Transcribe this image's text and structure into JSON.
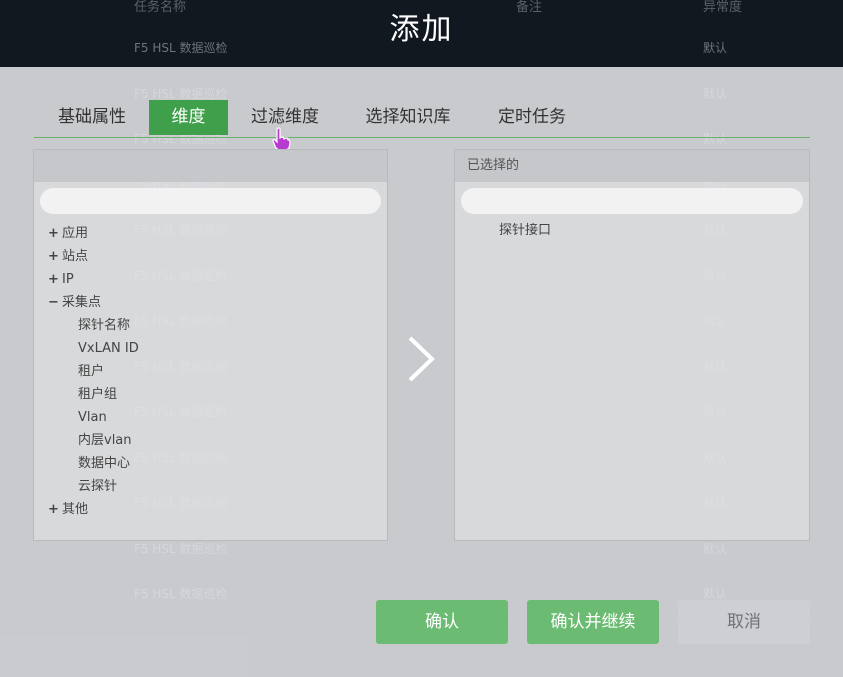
{
  "background": {
    "headers": [
      "任务名称",
      "备注",
      "异常度"
    ],
    "rows": [
      {
        "name": "F5 HSL 数据巡检",
        "level": "默认"
      },
      {
        "name": "F5 HSL 数据巡检",
        "level": "默认"
      },
      {
        "name": "F5 HSL 数据巡检",
        "level": "默认"
      },
      {
        "name": "F5 HSL 数据巡检",
        "level": "默认"
      },
      {
        "name": "F5 HSL 数据巡检",
        "level": "默认"
      },
      {
        "name": "F5 HSL 数据巡检",
        "level": "默认"
      },
      {
        "name": "F5 HSL 数据巡检",
        "level": "默认"
      },
      {
        "name": "F5 HSL 数据巡检",
        "level": "默认"
      },
      {
        "name": "F5 HSL 数据巡检",
        "level": "默认"
      },
      {
        "name": "F5 HSL 数据巡检",
        "level": "默认"
      },
      {
        "name": "F5 HSL 数据巡检",
        "level": "默认"
      },
      {
        "name": "F5 HSL 数据巡检",
        "level": "默认"
      },
      {
        "name": "F5 HSL 数据巡检",
        "level": "默认"
      }
    ]
  },
  "dialog": {
    "title": "添加",
    "tabs": [
      "基础属性",
      "维度",
      "过滤维度",
      "选择知识库",
      "定时任务"
    ],
    "active_tab": "维度",
    "left_panel": {
      "header": "",
      "tree": [
        {
          "sign": "+",
          "label": "应用"
        },
        {
          "sign": "+",
          "label": "站点"
        },
        {
          "sign": "+",
          "label": "IP"
        },
        {
          "sign": "−",
          "label": "采集点"
        },
        {
          "sign": "",
          "label": "探针名称"
        },
        {
          "sign": "",
          "label": "VxLAN ID"
        },
        {
          "sign": "",
          "label": "租户"
        },
        {
          "sign": "",
          "label": "租户组"
        },
        {
          "sign": "",
          "label": "Vlan"
        },
        {
          "sign": "",
          "label": "内层vlan"
        },
        {
          "sign": "",
          "label": "数据中心"
        },
        {
          "sign": "",
          "label": "云探针"
        },
        {
          "sign": "+",
          "label": "其他"
        }
      ]
    },
    "right_panel": {
      "header": "已选择的",
      "items": [
        "探针接口"
      ]
    },
    "buttons": {
      "confirm": "确认",
      "confirm_continue": "确认并继续",
      "cancel": "取消"
    }
  },
  "colors": {
    "accent_green": "#3f9f4a",
    "button_green": "#6cbb72"
  }
}
